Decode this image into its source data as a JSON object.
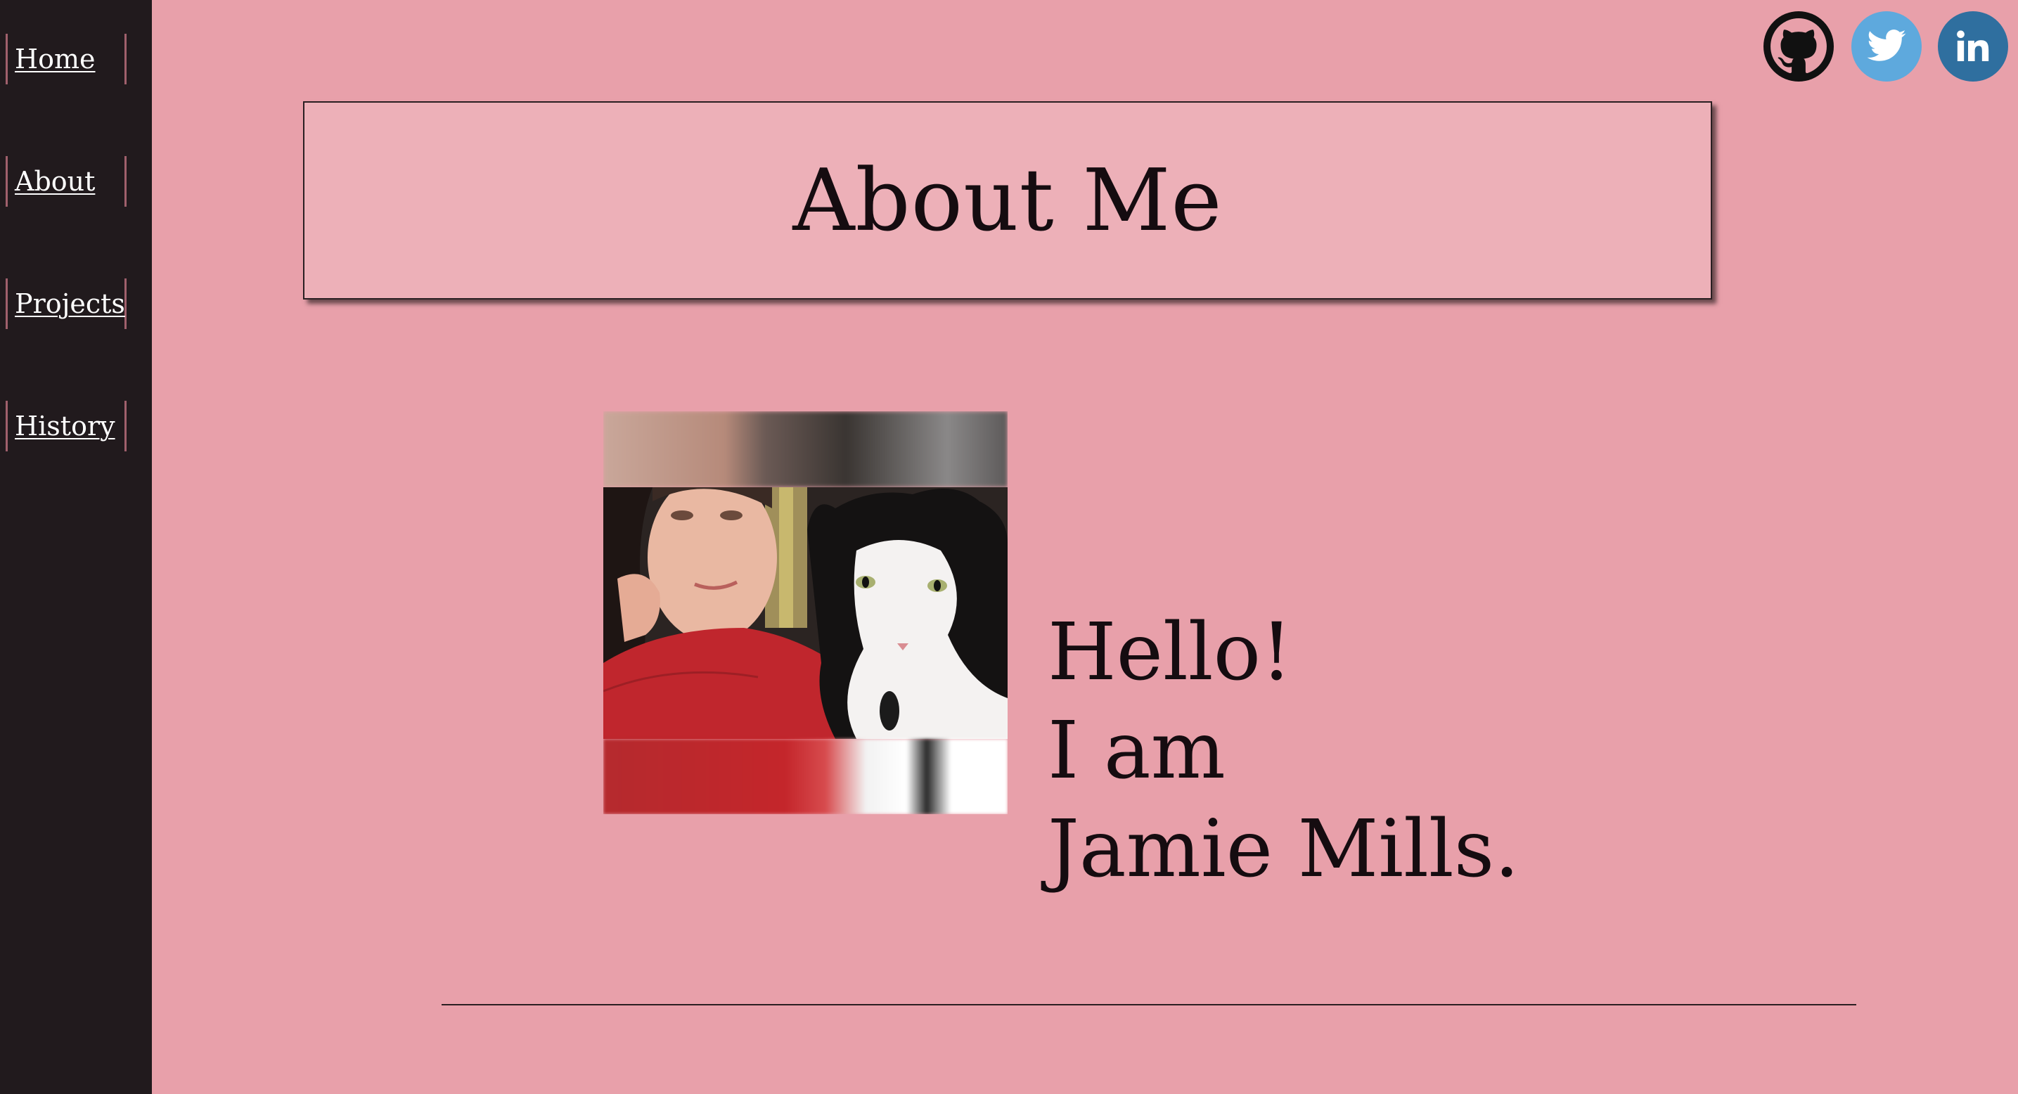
{
  "sidebar": {
    "items": [
      {
        "label": "Home"
      },
      {
        "label": "About"
      },
      {
        "label": "Projects"
      },
      {
        "label": "History"
      }
    ]
  },
  "social": [
    {
      "icon": "github-icon",
      "color": "#111111"
    },
    {
      "icon": "twitter-icon",
      "color": "#5ea9dd"
    },
    {
      "icon": "linkedin-icon",
      "color": "#2f6f9f"
    }
  ],
  "main": {
    "title": "About Me",
    "greeting": {
      "line1": "Hello!",
      "line2": "I am",
      "line3": "Jamie Mills."
    }
  },
  "colors": {
    "background": "#e8a0aa",
    "sidebar": "#211a1d",
    "title_box": "#edb0b8",
    "nav_border": "#a0606c"
  }
}
